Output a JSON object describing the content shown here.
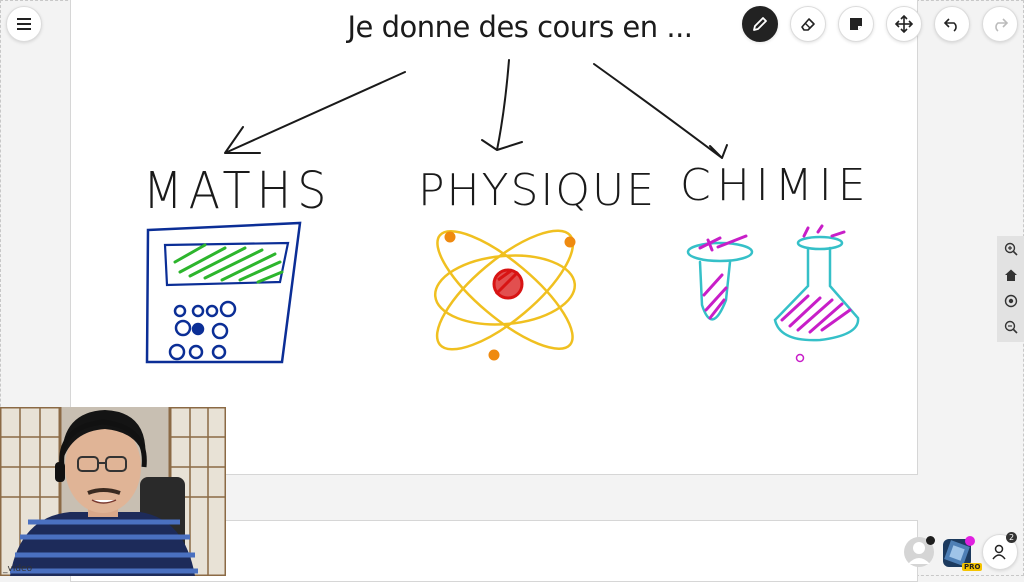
{
  "board": {
    "title": "Je donne des cours en ..."
  },
  "subjects": [
    {
      "label": "MATHS"
    },
    {
      "label": "PHYSIQUE"
    },
    {
      "label": "CHIMIE"
    }
  ],
  "toolbar": {
    "tools": [
      "pen-icon",
      "eraser-icon",
      "sticky-note-icon",
      "move-icon",
      "undo-icon",
      "redo-icon"
    ],
    "active_tool": "pen"
  },
  "zoom": {
    "buttons": [
      "zoom-in-icon",
      "home-icon",
      "center-icon",
      "zoom-out-icon"
    ]
  },
  "video": {
    "label": "_video"
  },
  "participants": {
    "count": "2",
    "pro_label": "PRO"
  },
  "colors": {
    "ink": "#1a1a1a",
    "calculator": "#0b2e96",
    "screen": "#2db52d",
    "atom_orbit": "#f0c020",
    "atom_nucleus": "#d81414",
    "electron": "#ef8a10",
    "flask_outline": "#35c0c8",
    "flask_liquid": "#c81ec8"
  }
}
